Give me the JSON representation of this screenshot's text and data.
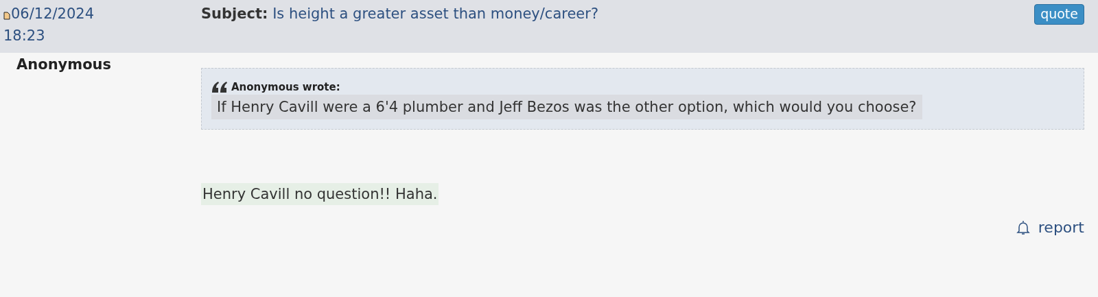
{
  "post": {
    "date": "06/12/2024",
    "time": "18:23",
    "subject_label": "Subject:",
    "subject": "Is height a greater asset than money/career?",
    "quote_button": "quote",
    "author": "Anonymous",
    "quote": {
      "attribution": "Anonymous wrote:",
      "text": "If Henry Cavill were a 6'4 plumber and Jeff Bezos was the other option, which would you choose?"
    },
    "reply": "Henry Cavill no question!! Haha.",
    "report_link": "report"
  }
}
